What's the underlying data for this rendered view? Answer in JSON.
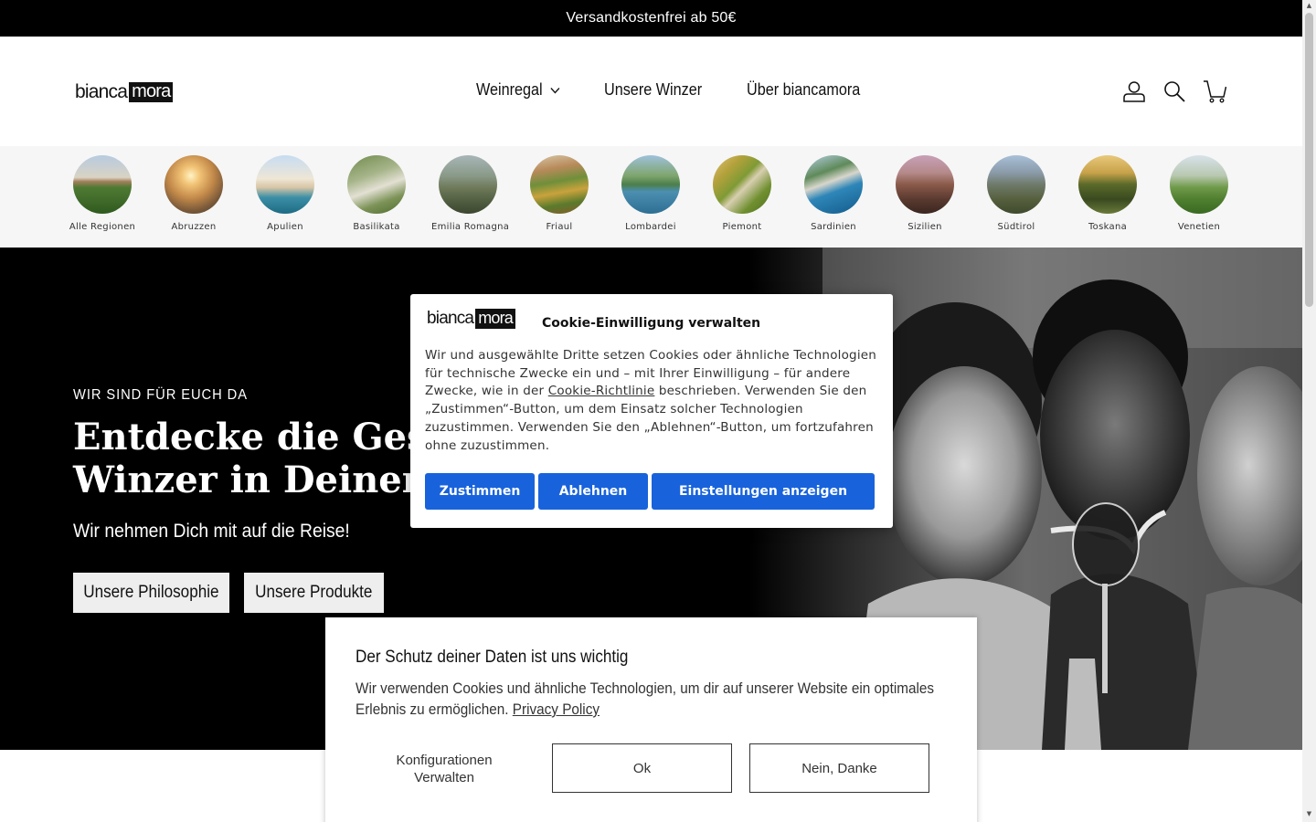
{
  "announcement": "Versandkostenfrei ab 50€",
  "brand": {
    "part1": "bianca",
    "part2": "mora"
  },
  "nav": [
    {
      "label": "Weinregal",
      "has_dropdown": true
    },
    {
      "label": "Unsere Winzer",
      "has_dropdown": false
    },
    {
      "label": "Über biancamora",
      "has_dropdown": false
    }
  ],
  "header_icons": [
    "account-icon",
    "search-icon",
    "cart-icon"
  ],
  "regions": [
    {
      "label": "Alle Regionen"
    },
    {
      "label": "Abruzzen"
    },
    {
      "label": "Apulien"
    },
    {
      "label": "Basilikata"
    },
    {
      "label": "Emilia Romagna"
    },
    {
      "label": "Friaul"
    },
    {
      "label": "Lombardei"
    },
    {
      "label": "Piemont"
    },
    {
      "label": "Sardinien"
    },
    {
      "label": "Sizilien"
    },
    {
      "label": "Südtirol"
    },
    {
      "label": "Toskana"
    },
    {
      "label": "Venetien"
    }
  ],
  "hero": {
    "kicker": "WIR SIND FÜR EUCH DA",
    "title_line1": "Entdecke die Geschichten der",
    "title_line2": "Winzer in Deinem Glas",
    "subtitle": "Wir nehmen Dich mit auf die Reise!",
    "button1": "Unsere Philosophie",
    "button2": "Unsere Produkte"
  },
  "consent": {
    "title": "Cookie-Einwilligung verwalten",
    "text_before_link": "Wir und ausgewählte Dritte setzen Cookies oder ähnliche Technologien für technische Zwecke ein und – mit Ihrer Einwilligung – für andere Zwecke, wie in der ",
    "link": "Cookie-Richtlinie",
    "text_after_link": " beschrieben. Verwenden Sie den „Zustimmen“-Button, um dem Einsatz solcher Technologien zuzustimmen. Verwenden Sie den „Ablehnen“-Button, um fortzufahren ohne zuzustimmen.",
    "accept": "Zustimmen",
    "reject": "Ablehnen",
    "settings": "Einstellungen anzeigen",
    "button_color": "#1863dc"
  },
  "privacy": {
    "title": "Der Schutz deiner Daten ist uns wichtig",
    "text": "Wir verwenden Cookies und ähnliche Technologien, um dir auf unserer Website ein optimales Erlebnis zu ermöglichen. ",
    "link": "Privacy Policy",
    "configure": "Konfigurationen Verwalten",
    "ok": "Ok",
    "decline": "Nein, Danke"
  }
}
